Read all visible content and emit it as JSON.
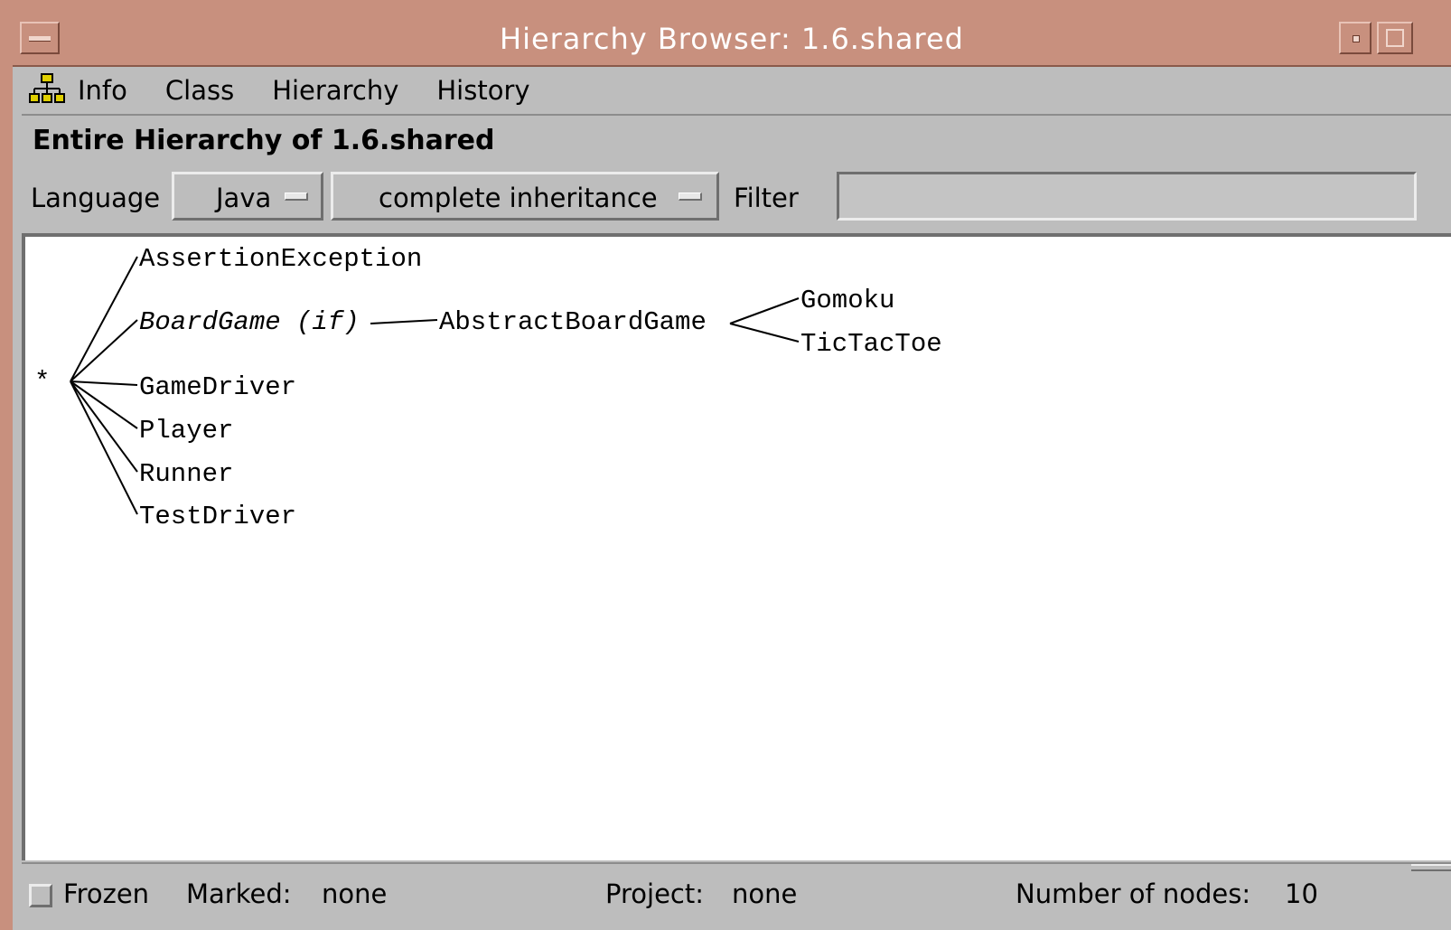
{
  "window": {
    "title": "Hierarchy Browser: 1.6.shared",
    "title_bar_color": "#c8907e"
  },
  "menubar": {
    "icon": "hierarchy-icon",
    "items": [
      {
        "label": "Info"
      },
      {
        "label": "Class"
      },
      {
        "label": "Hierarchy"
      },
      {
        "label": "History"
      }
    ]
  },
  "heading": "Entire Hierarchy of 1.6.shared",
  "controls": {
    "language_label": "Language",
    "language_value": "Java",
    "mode_value": "complete inheritance",
    "filter_label": "Filter",
    "filter_value": ""
  },
  "tree": {
    "root_label": "*",
    "nodes": [
      {
        "id": "assertion",
        "label": "AssertionException",
        "parent": "root",
        "interface": false
      },
      {
        "id": "boardgame",
        "label": "BoardGame (if)",
        "parent": "root",
        "interface": true
      },
      {
        "id": "abstractboard",
        "label": "AbstractBoardGame",
        "parent": "boardgame",
        "interface": false
      },
      {
        "id": "gomoku",
        "label": "Gomoku",
        "parent": "abstractboard",
        "interface": false
      },
      {
        "id": "tictactoe",
        "label": "TicTacToe",
        "parent": "abstractboard",
        "interface": false
      },
      {
        "id": "gamedriver",
        "label": "GameDriver",
        "parent": "root",
        "interface": false
      },
      {
        "id": "player",
        "label": "Player",
        "parent": "root",
        "interface": false
      },
      {
        "id": "runner",
        "label": "Runner",
        "parent": "root",
        "interface": false
      },
      {
        "id": "testdriver",
        "label": "TestDriver",
        "parent": "root",
        "interface": false
      }
    ]
  },
  "status": {
    "frozen_label": "Frozen",
    "frozen_checked": false,
    "marked_label": "Marked:",
    "marked_value": "none",
    "project_label": "Project:",
    "project_value": "none",
    "nodes_label": "Number of nodes:",
    "nodes_value": "10"
  }
}
